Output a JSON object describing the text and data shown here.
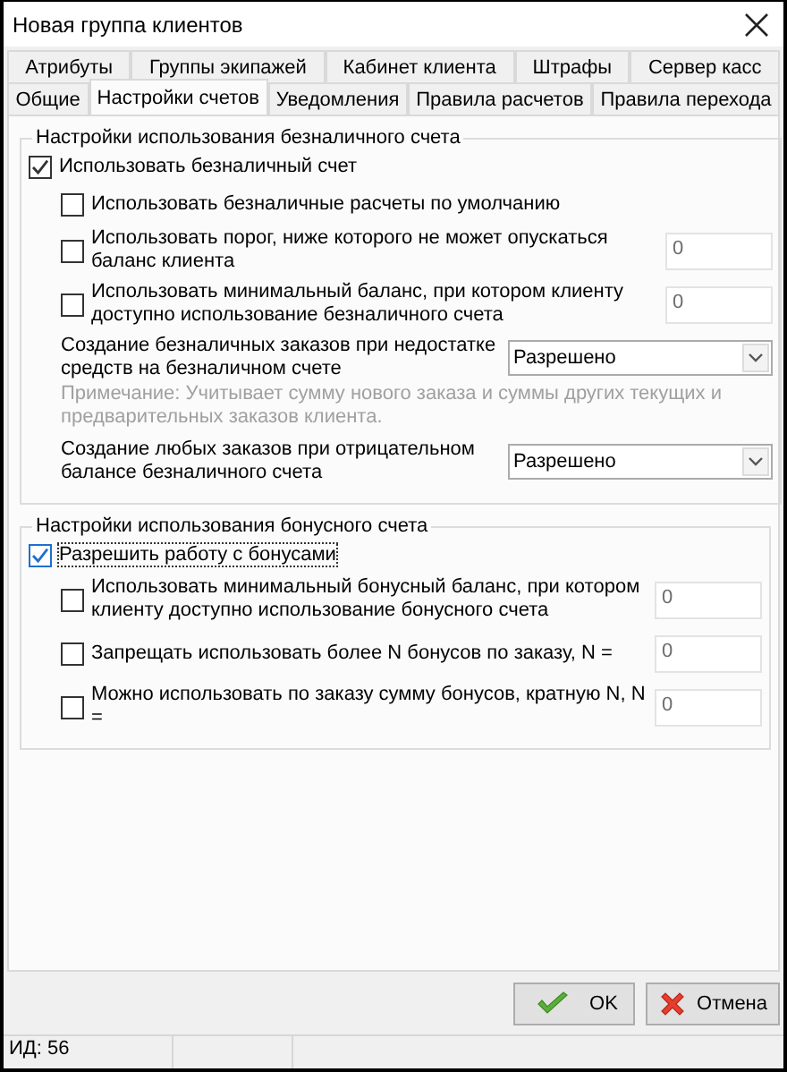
{
  "window": {
    "title": "Новая группа клиентов"
  },
  "tab_rows": [
    [
      {
        "label": "Атрибуты",
        "selected": false
      },
      {
        "label": "Группы экипажей",
        "selected": false
      },
      {
        "label": "Кабинет клиента",
        "selected": false
      },
      {
        "label": "Штрафы",
        "selected": false
      },
      {
        "label": "Сервер касс",
        "selected": false
      }
    ],
    [
      {
        "label": "Общие",
        "selected": false
      },
      {
        "label": "Настройки счетов",
        "selected": true
      },
      {
        "label": "Уведомления",
        "selected": false
      },
      {
        "label": "Правила расчетов",
        "selected": false
      },
      {
        "label": "Правила перехода",
        "selected": false
      }
    ]
  ],
  "groups": [
    {
      "title": "Настройки использования безналичного счета",
      "items": [
        {
          "kind": "check",
          "label": "Использовать безналичный счет",
          "checked": true,
          "focused": false,
          "children": [
            {
              "kind": "check",
              "label": "Использовать безналичные расчеты по умолчанию",
              "checked": false,
              "focused": false
            },
            {
              "kind": "check",
              "label": "Использовать порог, ниже которого не может опускаться баланс клиента",
              "checked": false,
              "focused": false,
              "value": "0"
            },
            {
              "kind": "check",
              "label": "Использовать минимальный баланс, при котором клиенту доступно использование безналичного счета",
              "checked": false,
              "focused": false,
              "value": "0"
            },
            {
              "kind": "combo",
              "label": "Создание безналичных заказов при недостатке средств на безналичном счете",
              "value": "Разрешено"
            },
            {
              "kind": "note",
              "label": "Примечание: Учитывает сумму нового заказа и суммы других текущих и предварительных заказов клиента."
            },
            {
              "kind": "combo",
              "label": "Создание любых заказов при отрицательном балансе безналичного счета",
              "value": "Разрешено"
            }
          ]
        }
      ]
    },
    {
      "title": "Настройки использования бонусного счета",
      "items": [
        {
          "kind": "check",
          "label": "Разрешить работу с бонусами",
          "checked": true,
          "focused": true,
          "children": [
            {
              "kind": "check",
              "label": "Использовать минимальный бонусный баланс, при котором клиенту доступно использование бонусного счета",
              "checked": false,
              "focused": false,
              "value": "0"
            },
            {
              "kind": "check",
              "label": "Запрещать использовать более N бонусов по заказу, N =",
              "checked": false,
              "focused": false,
              "value": "0"
            },
            {
              "kind": "check",
              "label": "Можно использовать по заказу сумму бонусов, кратную N, N =",
              "checked": false,
              "focused": false,
              "value": "0"
            }
          ]
        }
      ]
    }
  ],
  "buttons": [
    {
      "kind": "ok",
      "label": "OK"
    },
    {
      "kind": "cancel",
      "label": "Отмена"
    }
  ],
  "status_bar": [
    "ИД: 56"
  ]
}
